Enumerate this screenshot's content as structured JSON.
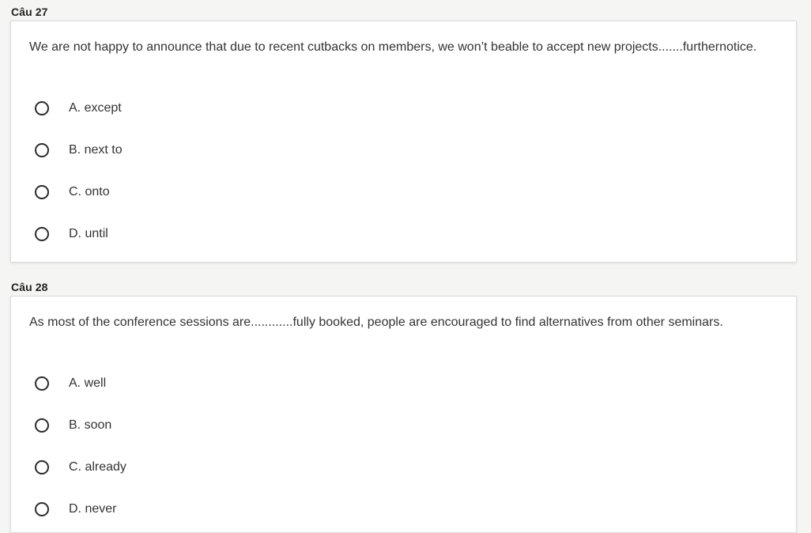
{
  "questions": [
    {
      "title": "Câu 27",
      "text": "We are not happy to announce that due to recent cutbacks on members, we won’t beable to accept new projects.......furthernotice.",
      "options": [
        "A. except",
        "B. next to",
        "C. onto",
        "D. until"
      ]
    },
    {
      "title": "Câu 28",
      "text": "As most of the conference sessions are............fully booked, people are encouraged to find alternatives from other seminars.",
      "options": [
        "A. well",
        "B. soon",
        "C. already",
        "D. never"
      ]
    }
  ]
}
